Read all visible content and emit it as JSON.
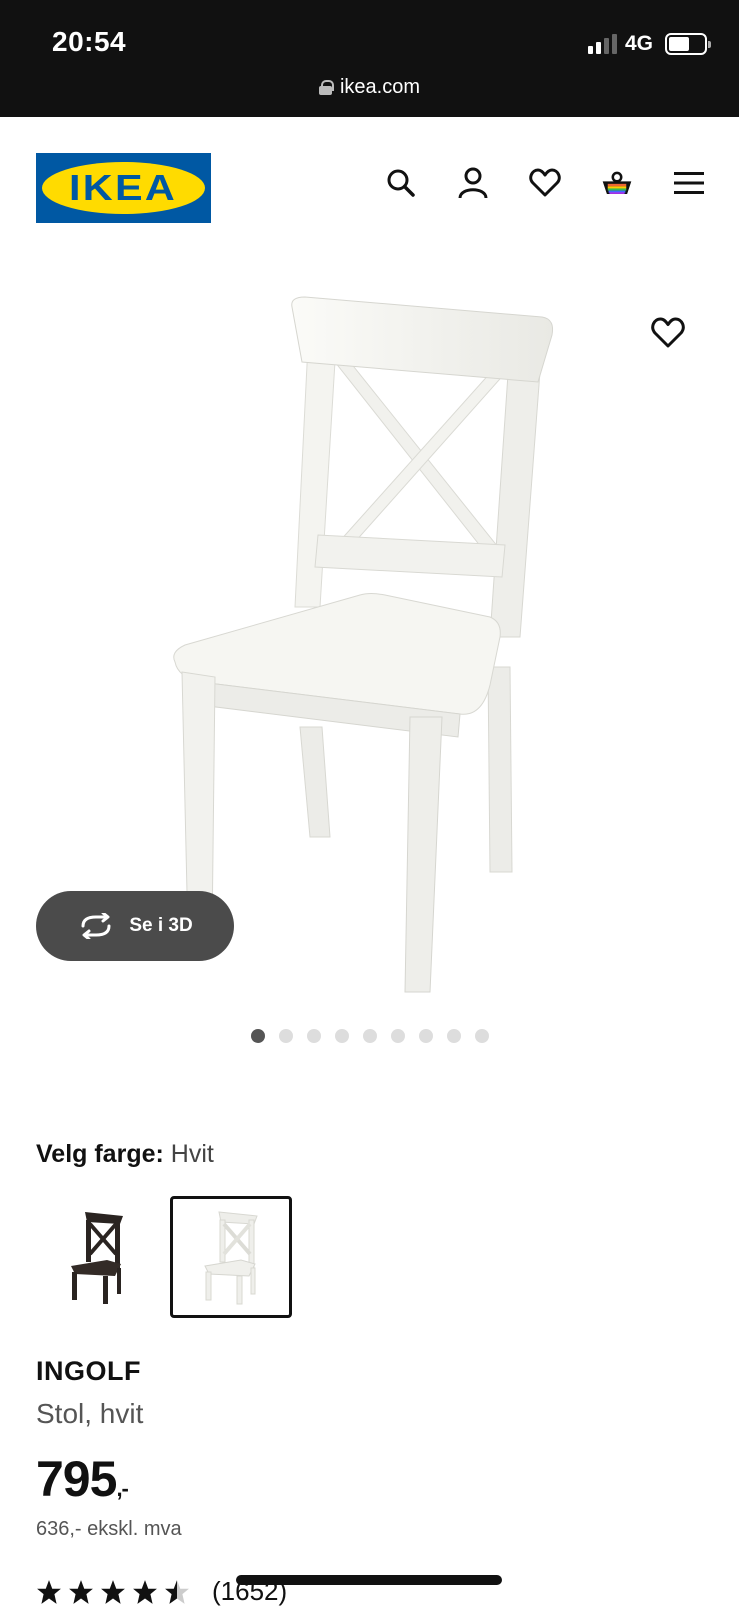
{
  "status_bar": {
    "time": "20:54",
    "network": "4G",
    "battery_level": 0.6
  },
  "browser": {
    "url": "ikea.com"
  },
  "header": {
    "logo_text": "IKEA",
    "icons": [
      "search-icon",
      "account-icon",
      "wishlist-icon",
      "cart-icon",
      "menu-icon"
    ]
  },
  "gallery": {
    "view_3d_label": "Se i 3D",
    "image_count": 9,
    "active_index": 0
  },
  "product": {
    "color_label": "Velg farge:",
    "color_value": "Hvit",
    "swatches": [
      {
        "color": "black-brown",
        "selected": false
      },
      {
        "color": "white",
        "selected": true
      }
    ],
    "name": "INGOLF",
    "description": "Stol, hvit",
    "price": "795",
    "price_suffix": ",-",
    "price_ex_vat": "636,- ekskl. mva",
    "rating": 4.5,
    "rating_count": "(1652)"
  },
  "colors": {
    "brand_blue": "#0058a3",
    "brand_yellow": "#ffdb00"
  }
}
